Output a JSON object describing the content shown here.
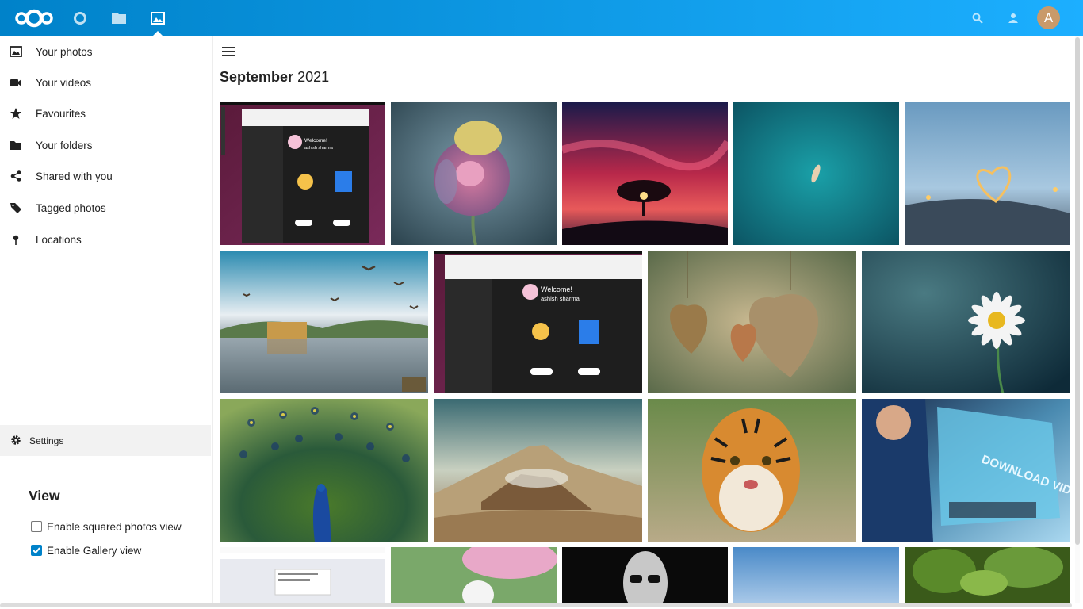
{
  "header": {
    "apps": [
      "dashboard-icon",
      "files-icon",
      "photos-icon"
    ],
    "avatar_letter": "A",
    "accent": "#0082c9"
  },
  "sidebar": {
    "items": [
      {
        "label": "Your photos",
        "icon": "image-icon"
      },
      {
        "label": "Your videos",
        "icon": "video-icon"
      },
      {
        "label": "Favourites",
        "icon": "star-icon"
      },
      {
        "label": "Your folders",
        "icon": "folder-icon"
      },
      {
        "label": "Shared with you",
        "icon": "share-icon"
      },
      {
        "label": "Tagged photos",
        "icon": "tag-icon"
      },
      {
        "label": "Locations",
        "icon": "map-marker-icon"
      }
    ],
    "settings_label": "Settings",
    "view_title": "View",
    "options": [
      {
        "label": "Enable squared photos view",
        "checked": false
      },
      {
        "label": "Enable Gallery view",
        "checked": true
      }
    ]
  },
  "main": {
    "month": "September",
    "year": "2021",
    "photos": [
      {
        "name": "photo-screenshot-welcome"
      },
      {
        "name": "photo-rose"
      },
      {
        "name": "photo-tree-sunset"
      },
      {
        "name": "photo-ocean-boat"
      },
      {
        "name": "photo-heart-lights"
      },
      {
        "name": "photo-lake-palace-birds"
      },
      {
        "name": "photo-screenshot-welcome-2"
      },
      {
        "name": "photo-wooden-hearts"
      },
      {
        "name": "photo-daisy"
      },
      {
        "name": "photo-peacock"
      },
      {
        "name": "photo-volcano"
      },
      {
        "name": "photo-tiger"
      },
      {
        "name": "photo-download-video"
      },
      {
        "name": "photo-browser-screenshot"
      },
      {
        "name": "photo-dog-blossoms"
      },
      {
        "name": "photo-woman-sunglasses"
      },
      {
        "name": "photo-sky"
      },
      {
        "name": "photo-green-forest"
      }
    ],
    "screenshot_text": {
      "welcome": "Welcome!",
      "user": "ashish sharma"
    },
    "download_video_text": "DOWNLOAD VIDEO"
  }
}
